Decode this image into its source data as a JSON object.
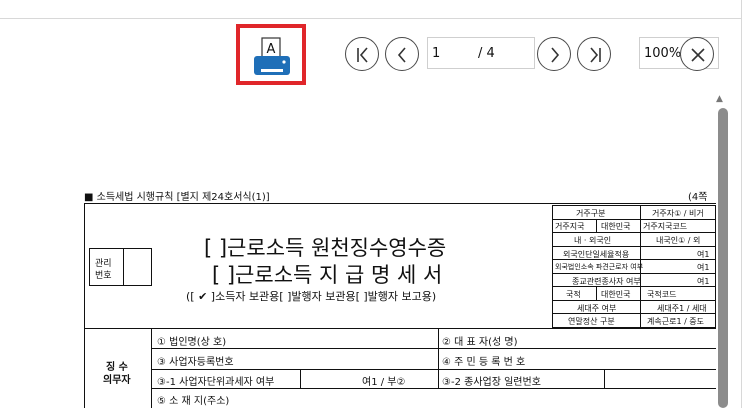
{
  "toolbar": {
    "print_icon_letter": "A",
    "page_current": "1",
    "page_total": "/ 4",
    "zoom": "100%"
  },
  "document": {
    "form_header": "■ 소득세법 시행규칙 [별지 제24호서식(1)]",
    "form_pages": "(4쪽",
    "mgmt_label_1": "관리",
    "mgmt_label_2": "번호",
    "title_line_1": "[  ]근로소득 원천징수영수증",
    "title_line_2": "[  ]근로소득 지 급 명 세 서",
    "subtitle": "([ ✔ ]소득자 보관용[     ]발행자 보관용[     ]발행자 보고용)",
    "side_table": [
      [
        "거주구분",
        "거주자① / 비거"
      ],
      [
        "거주지국",
        "대한민국",
        "거주지국코드"
      ],
      [
        "내 · 외국인",
        "내국인① / 외"
      ],
      [
        "외국인단일세율적용",
        "여1"
      ],
      [
        "외국법인소속 파견근로자 여부",
        "여1"
      ],
      [
        "종교관련종사자 여부",
        "여1"
      ],
      [
        "국적",
        "대한민국",
        "국적코드"
      ],
      [
        "세대주 여부",
        "세대주1 / 세대"
      ],
      [
        "연말정산 구분",
        "계속근로1 / 중도"
      ]
    ],
    "payer_label_1": "징  수",
    "payer_label_2": "의무자",
    "rows": {
      "r1_label": "① 법인명(상 호)",
      "r1_right": "② 대 표 자(성   명)",
      "r2_label": "③ 사업자등록번호",
      "r2_right": "④ 주 민 등 록 번 호",
      "r3_label": "③-1 사업자단위과세자 여부",
      "r3_value": "여1 / 부②",
      "r3_right": "③-2 종사업장 일련번호",
      "r4_label": "⑤ 소 재 지(주소)"
    }
  }
}
